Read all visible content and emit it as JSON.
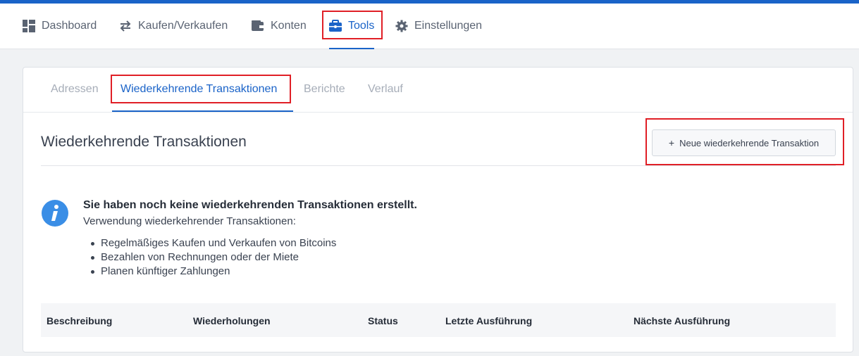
{
  "nav": {
    "items": [
      {
        "label": "Dashboard",
        "icon": "dashboard-icon"
      },
      {
        "label": "Kaufen/Verkaufen",
        "icon": "exchange-arrows-icon"
      },
      {
        "label": "Konten",
        "icon": "wallet-icon"
      },
      {
        "label": "Tools",
        "icon": "briefcase-icon"
      },
      {
        "label": "Einstellungen",
        "icon": "gear-icon"
      }
    ],
    "active": "Tools"
  },
  "tabs": {
    "items": [
      "Adressen",
      "Wiederkehrende Transaktionen",
      "Berichte",
      "Verlauf"
    ],
    "active": "Wiederkehrende Transaktionen"
  },
  "section": {
    "title": "Wiederkehrende Transaktionen",
    "new_button_label": "Neue wiederkehrende Transaktion",
    "new_button_icon": "+"
  },
  "info": {
    "heading": "Sie haben noch keine wiederkehrenden Transaktionen erstellt.",
    "subtitle": "Verwendung wiederkehrender Transaktionen:",
    "bullets": [
      "Regelmäßiges Kaufen und Verkaufen von Bitcoins",
      "Bezahlen von Rechnungen oder der Miete",
      "Planen künftiger Zahlungen"
    ]
  },
  "table": {
    "columns": [
      "Beschreibung",
      "Wiederholungen",
      "Status",
      "Letzte Ausführung",
      "Nächste Ausführung"
    ]
  },
  "colors": {
    "accent": "#1a63c8",
    "highlight": "#e01f26",
    "info_icon": "#3a8ee6"
  }
}
